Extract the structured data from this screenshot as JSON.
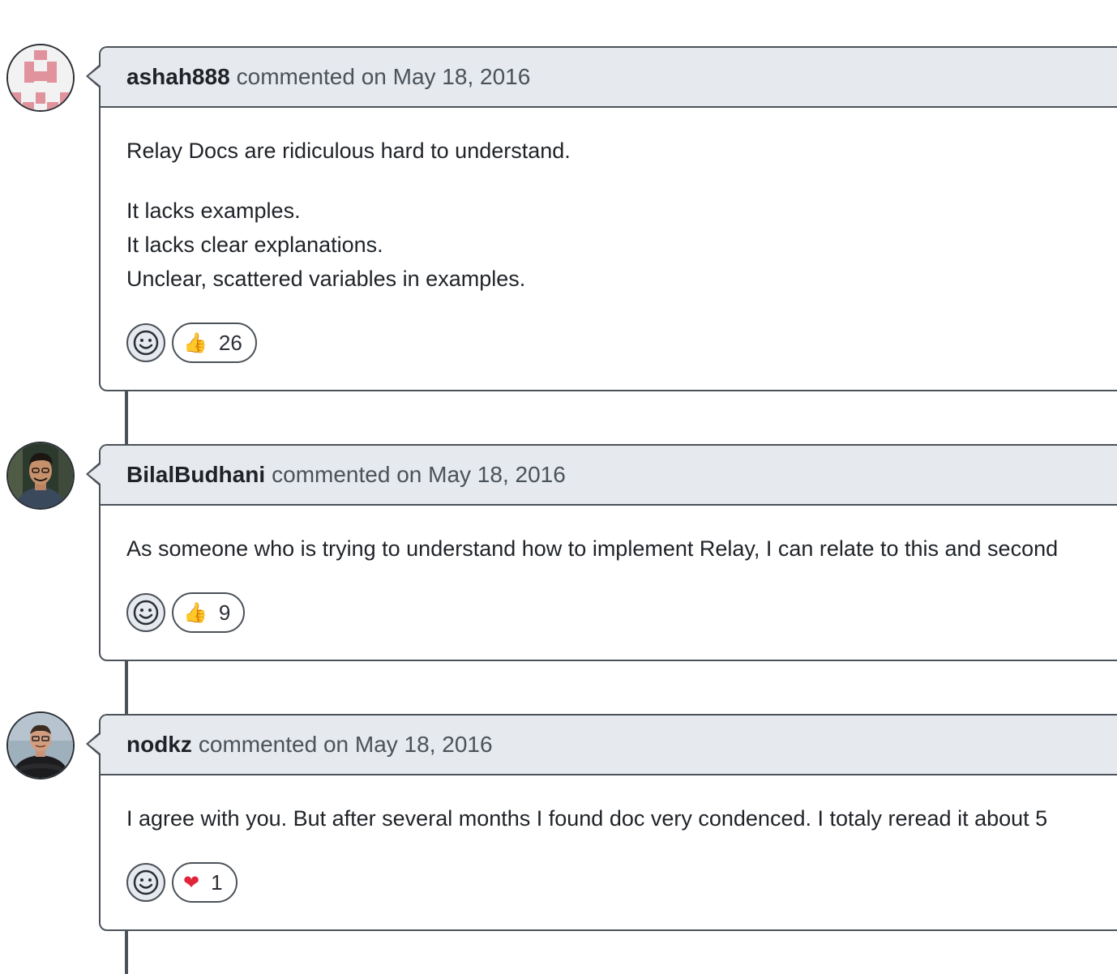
{
  "comments": [
    {
      "author": "ashah888",
      "meta": "commented on May 18, 2016",
      "body": [
        "Relay Docs are ridiculous hard to understand.",
        "It lacks examples.",
        "It lacks clear explanations.",
        "Unclear, scattered variables in examples."
      ],
      "reaction": {
        "icon": "thumbs-up-icon",
        "emoji": "👍",
        "count": "26"
      }
    },
    {
      "author": "BilalBudhani",
      "meta": "commented on May 18, 2016",
      "body": [
        "As someone who is trying to understand how to implement Relay, I can relate to this and second"
      ],
      "reaction": {
        "icon": "thumbs-up-icon",
        "emoji": "👍",
        "count": "9"
      }
    },
    {
      "author": "nodkz",
      "meta": "commented on May 18, 2016",
      "body": [
        "I agree with you. But after several months I found doc very condenced. I totaly reread it about 5"
      ],
      "reaction": {
        "icon": "heart-icon",
        "emoji": "❤",
        "count": "1"
      }
    }
  ],
  "colors": {
    "header_bg": "#e6e9ee",
    "border": "#4b5259",
    "meta_text": "#4a525a",
    "identicon": "#e0939c"
  }
}
